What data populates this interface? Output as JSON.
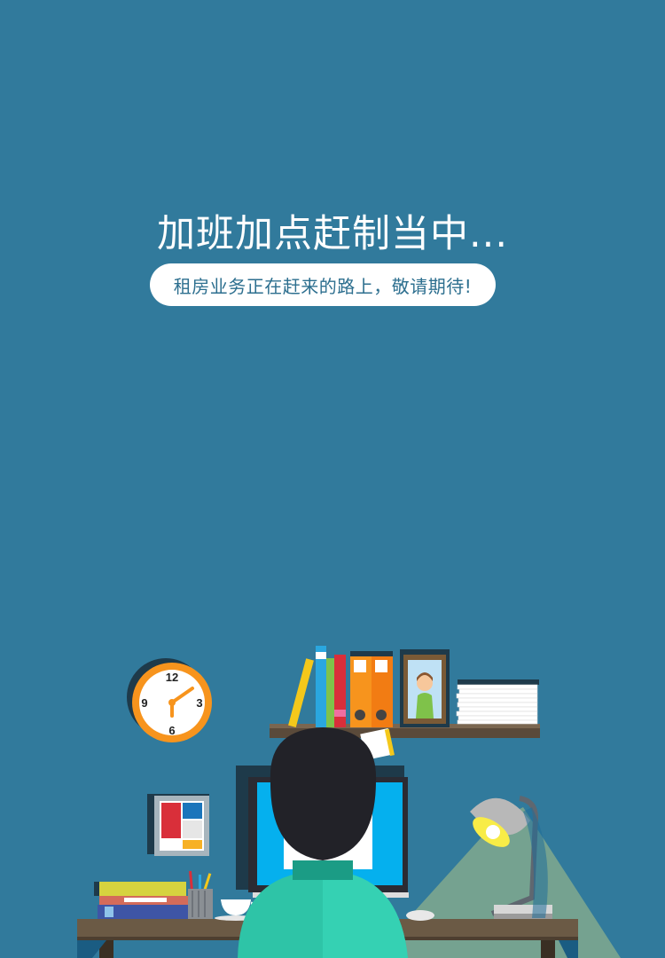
{
  "headline": "加班加点赶制当中...",
  "subline": "租房业务正在赶来的路上，敬请期待!",
  "illustration": {
    "clock": {
      "numbers": [
        "12",
        "3",
        "6",
        "9"
      ]
    }
  },
  "colors": {
    "background": "#317a9c",
    "pill_background": "#ffffff",
    "pill_text": "#2d6f8f",
    "clock_ring": "#f7941d",
    "desk": "#6b5a45",
    "monitor_screen": "#05b0ee",
    "shirt": "#2ec4a7",
    "lamp_light": "#f8ec47"
  }
}
